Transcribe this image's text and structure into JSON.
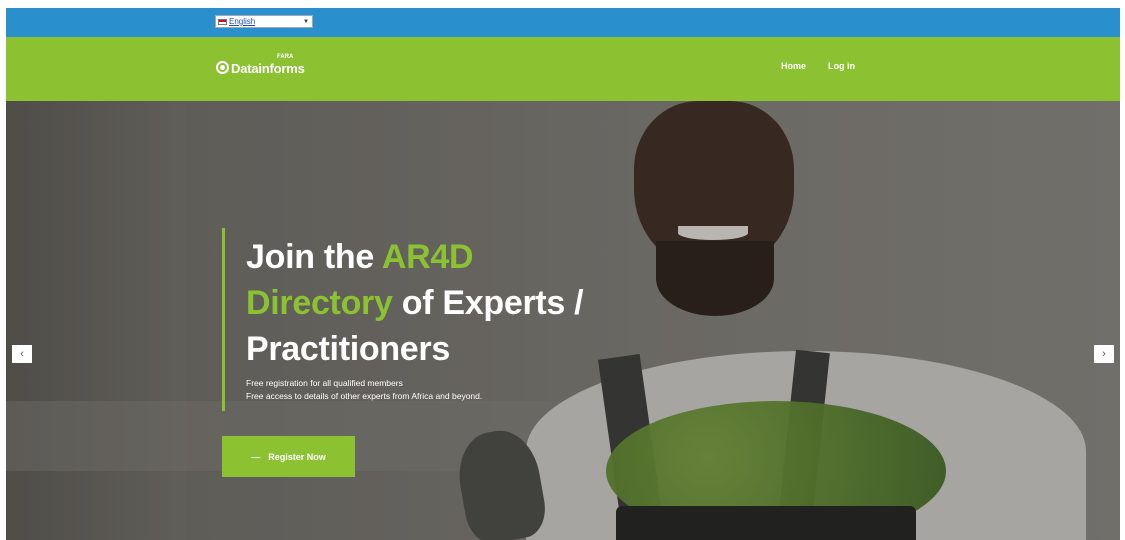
{
  "language_bar": {
    "selected_language": "English",
    "color": "#2a8fcd"
  },
  "header": {
    "logo": {
      "name": "Datainforms",
      "superscript": "FARA"
    },
    "nav": [
      {
        "label": "Home"
      },
      {
        "label": "Log in"
      }
    ],
    "color": "#8cc131"
  },
  "hero": {
    "headline_white_1": "Join the ",
    "headline_green_1": "AR4D",
    "headline_green_2": "Directory",
    "headline_white_2": " of Experts /",
    "headline_white_3": "Practitioners",
    "sub_line_1": "Free registration for all qualified members",
    "sub_line_2": "Free access to details of other experts from Africa and beyond.",
    "cta_dash": "—",
    "cta_label": "Register Now",
    "prev_arrow": "‹",
    "next_arrow": "›",
    "accent_color": "#8cc131"
  },
  "icons": [
    "flag-icon",
    "dropdown-caret-icon",
    "logo-icon",
    "chevron-left-icon",
    "chevron-right-icon"
  ]
}
